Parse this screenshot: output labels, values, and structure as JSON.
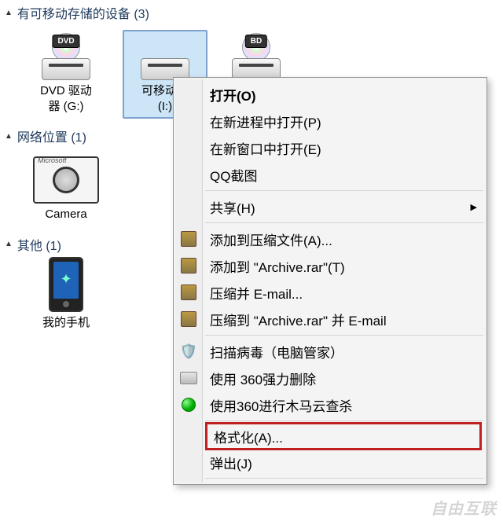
{
  "sections": {
    "removable": {
      "title": "有可移动存储的设备 (3)"
    },
    "network": {
      "title": "网络位置 (1)"
    },
    "other": {
      "title": "其他 (1)"
    }
  },
  "devices": {
    "dvd": {
      "label_line1": "DVD 驱动",
      "label_line2": "器 (G:)",
      "badge": "DVD"
    },
    "removable": {
      "label_line1": "可移动磁",
      "label_line2": "(I:)"
    },
    "bd": {
      "label_line1": "",
      "badge": "BD"
    },
    "camera": {
      "label": "Camera",
      "brand": "Microsoft"
    },
    "phone": {
      "label": "我的手机"
    }
  },
  "menu": {
    "open": "打开(O)",
    "open_proc": "在新进程中打开(P)",
    "open_window": "在新窗口中打开(E)",
    "qq_shot": "QQ截图",
    "share": "共享(H)",
    "add_archive": "添加到压缩文件(A)...",
    "add_rar": "添加到 \"Archive.rar\"(T)",
    "compress_mail": "压缩并 E-mail...",
    "compress_rar_mail": "压缩到 \"Archive.rar\" 并 E-mail",
    "scan_virus": "扫描病毒（电脑管家）",
    "force_delete": "使用 360强力删除",
    "cloud_scan": "使用360进行木马云查杀",
    "format": "格式化(A)...",
    "eject": "弹出(J)"
  },
  "watermark": "自由互联"
}
